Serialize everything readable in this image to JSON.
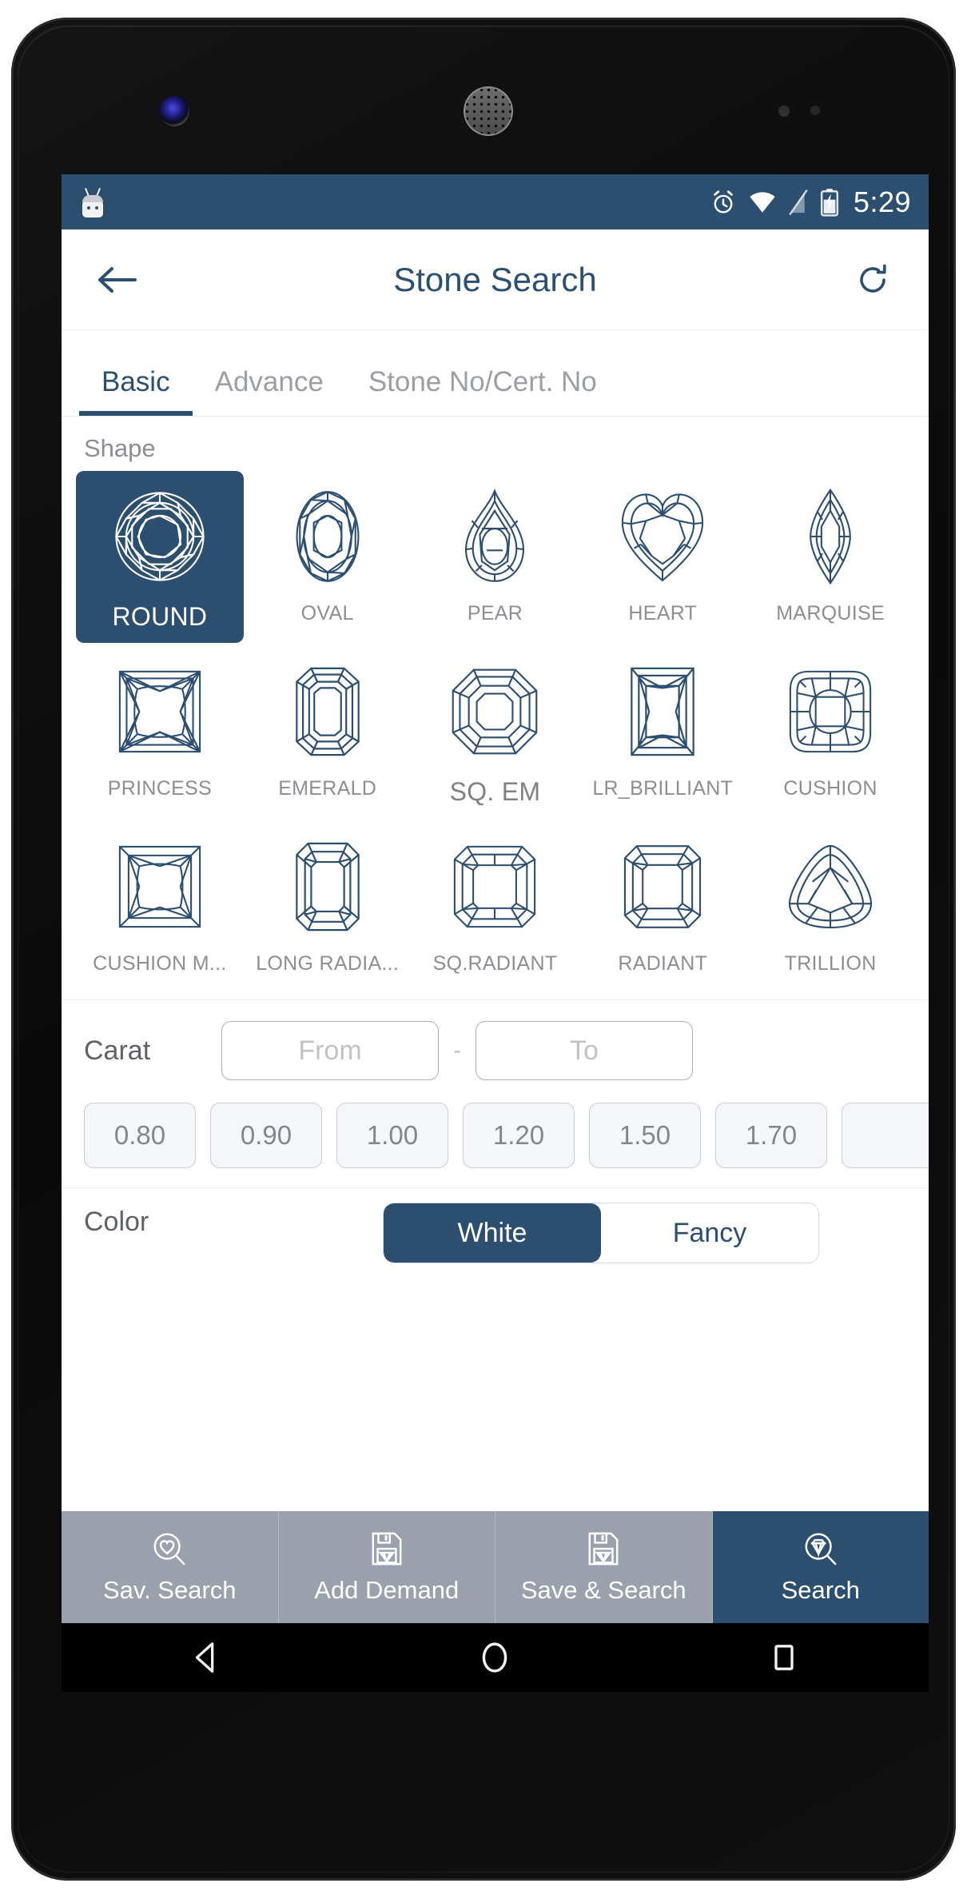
{
  "statusbar": {
    "time": "5:29",
    "icons": [
      "android-robot-icon",
      "alarm-icon",
      "wifi-icon",
      "signal-off-icon",
      "battery-charging-icon"
    ]
  },
  "appbar": {
    "back_icon": "back-arrow-icon",
    "title": "Stone Search",
    "refresh_icon": "refresh-icon"
  },
  "tabs": [
    {
      "label": "Basic",
      "active": true
    },
    {
      "label": "Advance",
      "active": false
    },
    {
      "label": "Stone No/Cert. No",
      "active": false
    }
  ],
  "shape": {
    "section_label": "Shape",
    "items": [
      {
        "label": "ROUND",
        "icon": "round-diamond-icon",
        "selected": true
      },
      {
        "label": "OVAL",
        "icon": "oval-diamond-icon",
        "selected": false
      },
      {
        "label": "PEAR",
        "icon": "pear-diamond-icon",
        "selected": false
      },
      {
        "label": "HEART",
        "icon": "heart-diamond-icon",
        "selected": false
      },
      {
        "label": "MARQUISE",
        "icon": "marquise-diamond-icon",
        "selected": false
      },
      {
        "label": "PRINCESS",
        "icon": "princess-diamond-icon",
        "selected": false
      },
      {
        "label": "EMERALD",
        "icon": "emerald-diamond-icon",
        "selected": false
      },
      {
        "label": "SQ. EM",
        "icon": "square-emerald-diamond-icon",
        "selected": false
      },
      {
        "label": "LR_BRILLIANT",
        "icon": "lr-brilliant-diamond-icon",
        "selected": false
      },
      {
        "label": "CUSHION",
        "icon": "cushion-diamond-icon",
        "selected": false
      },
      {
        "label": "CUSHION M...",
        "icon": "cushion-modified-diamond-icon",
        "selected": false
      },
      {
        "label": "LONG RADIA...",
        "icon": "long-radiant-diamond-icon",
        "selected": false
      },
      {
        "label": "SQ.RADIANT",
        "icon": "square-radiant-diamond-icon",
        "selected": false
      },
      {
        "label": "RADIANT",
        "icon": "radiant-diamond-icon",
        "selected": false
      },
      {
        "label": "TRILLION",
        "icon": "trillion-diamond-icon",
        "selected": false
      }
    ]
  },
  "carat": {
    "label": "Carat",
    "from_value": "",
    "from_placeholder": "From",
    "separator": "-",
    "to_value": "",
    "to_placeholder": "To",
    "quick_values": [
      "0.80",
      "0.90",
      "1.00",
      "1.20",
      "1.50",
      "1.70",
      ""
    ]
  },
  "color": {
    "label": "Color",
    "options": [
      {
        "label": "White",
        "active": true
      },
      {
        "label": "Fancy",
        "active": false
      }
    ]
  },
  "actions": [
    {
      "label": "Sav. Search",
      "icon": "heart-search-icon",
      "primary": false
    },
    {
      "label": "Add Demand",
      "icon": "save-diamond-icon",
      "primary": false
    },
    {
      "label": "Save & Search",
      "icon": "save-diamond-icon",
      "primary": false
    },
    {
      "label": "Search",
      "icon": "diamond-search-icon",
      "primary": true
    }
  ],
  "navbar": {
    "back": "nav-back-icon",
    "home": "nav-home-icon",
    "recents": "nav-recents-icon"
  },
  "colors": {
    "navy": "#2c4f70",
    "muted_text": "#8b8e93",
    "action_bar": "#9aa0ac"
  }
}
